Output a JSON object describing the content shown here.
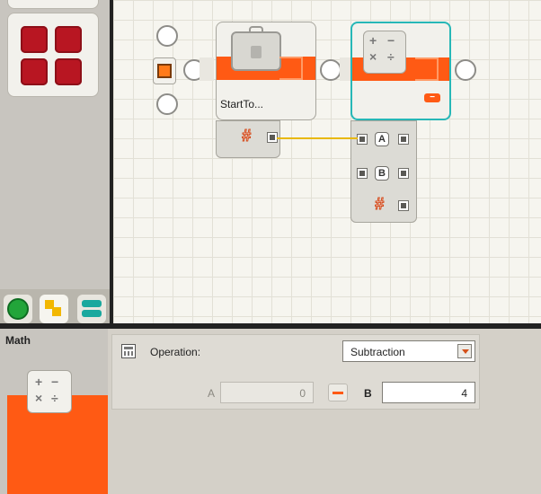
{
  "colors": {
    "accent": "#ff5a14",
    "selected_outline": "#27b7b7",
    "wire": "#e8b80a"
  },
  "canvas": {
    "start_block": {
      "label": "StartTo...",
      "icon": "suitcase-icon"
    },
    "math_block": {
      "icon": "math-ops-icon",
      "ops": [
        "+",
        "−",
        "×",
        "÷"
      ],
      "mode_glyph": "−",
      "inputs": [
        "A",
        "B"
      ],
      "output": "#"
    },
    "start_output": "#"
  },
  "config": {
    "section_title": "Math",
    "operation_label": "Operation:",
    "operation_value": "Subtraction",
    "a_label": "A",
    "a_value": "0",
    "minus_glyph": "−",
    "b_label": "B",
    "b_value": "4"
  }
}
